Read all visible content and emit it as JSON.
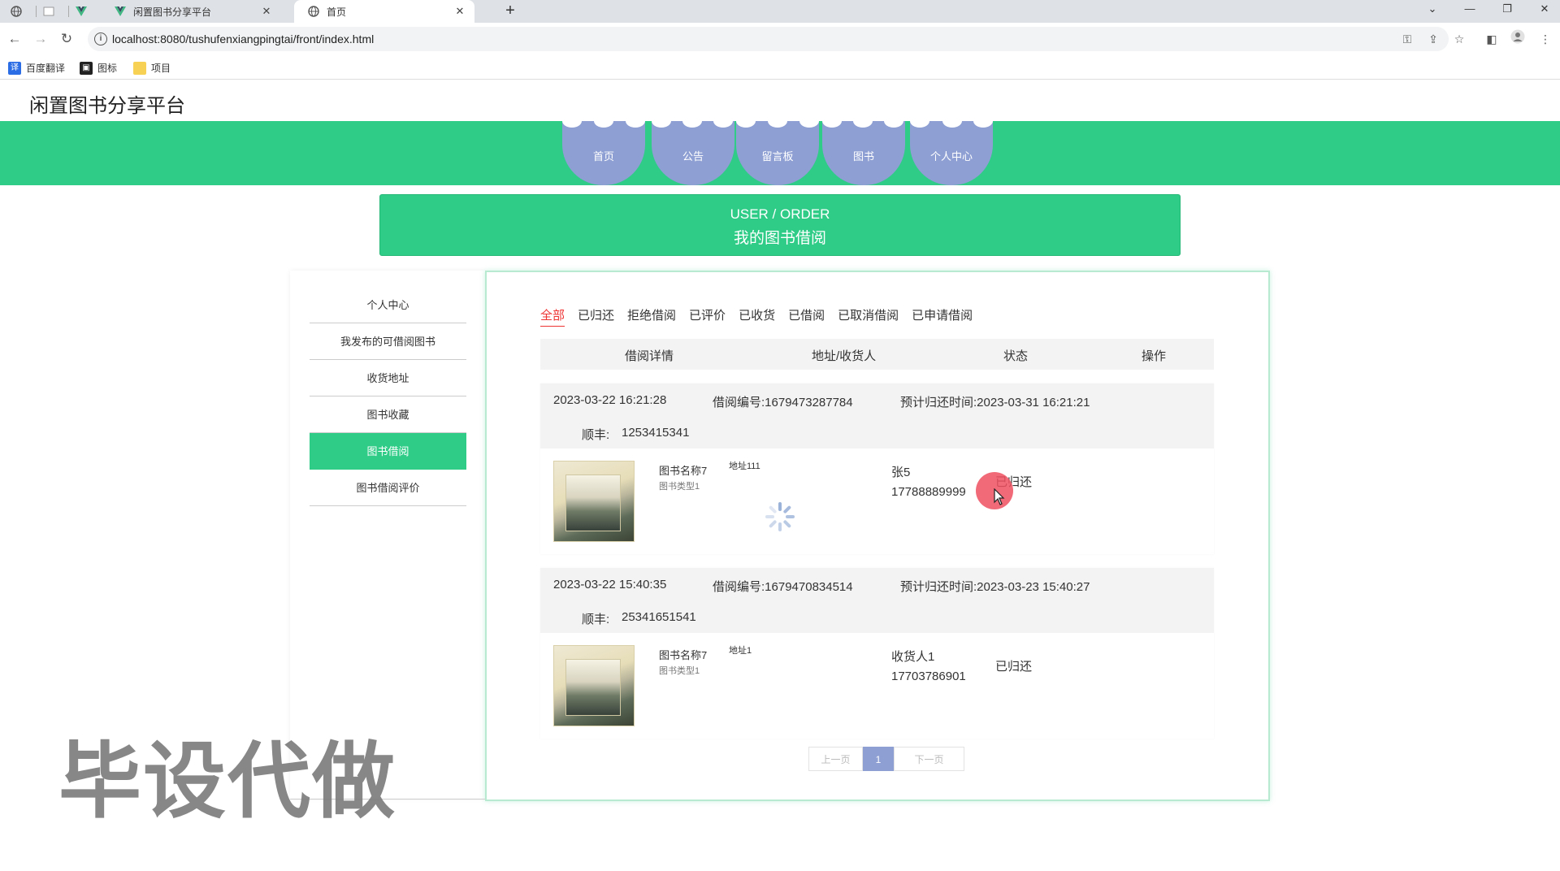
{
  "browser": {
    "tabs": [
      {
        "title": "闲置图书分享平台",
        "active": false
      },
      {
        "title": "首页",
        "active": true
      }
    ],
    "url": "localhost:8080/tushufenxiangpingtai/front/index.html",
    "bookmarks": [
      "百度翻译",
      "图标",
      "项目"
    ]
  },
  "site": {
    "title": "闲置图书分享平台"
  },
  "nav": {
    "items": [
      "首页",
      "公告",
      "留言板",
      "图书",
      "个人中心"
    ]
  },
  "banner": {
    "en": "USER / ORDER",
    "cn": "我的图书借阅"
  },
  "sidebar": {
    "items": [
      "个人中心",
      "我发布的可借阅图书",
      "收货地址",
      "图书收藏",
      "图书借阅",
      "图书借阅评价"
    ],
    "active_index": 4
  },
  "filters": {
    "items": [
      "全部",
      "已归还",
      "拒绝借阅",
      "已评价",
      "已收货",
      "已借阅",
      "已取消借阅",
      "已申请借阅"
    ],
    "active_index": 0
  },
  "table_headers": [
    "借阅详情",
    "地址/收货人",
    "状态",
    "操作"
  ],
  "orders": [
    {
      "time": "2023-03-22 16:21:28",
      "order_no": "借阅编号:1679473287784",
      "due": "预计归还时间:2023-03-31 16:21:21",
      "express": "顺丰:",
      "express_no": "1253415341",
      "book_name": "图书名称7",
      "book_type": "图书类型1",
      "address": "地址111",
      "receiver": "张5",
      "phone": "17788889999",
      "status": "已归还"
    },
    {
      "time": "2023-03-22 15:40:35",
      "order_no": "借阅编号:1679470834514",
      "due": "预计归还时间:2023-03-23 15:40:27",
      "express": "顺丰:",
      "express_no": "25341651541",
      "book_name": "图书名称7",
      "book_type": "图书类型1",
      "address": "地址1",
      "receiver": "收货人1",
      "phone": "17703786901",
      "status": "已归还"
    }
  ],
  "pagination": {
    "prev": "上一页",
    "current": "1",
    "next": "下一页"
  },
  "watermark": "毕设代做"
}
